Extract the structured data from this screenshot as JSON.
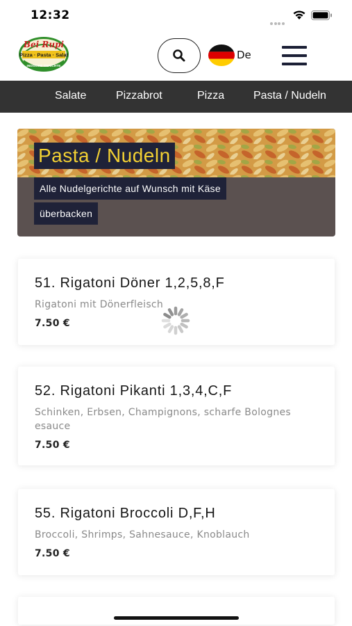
{
  "status_bar": {
    "time": "12:32"
  },
  "header": {
    "logo_text": "Bei Rupi",
    "logo_subtitle": "Pizza · Pasta · Salat",
    "logo_tagline": "INDISCHE GERICHTE",
    "language": "De"
  },
  "nav": {
    "items": [
      "Salate",
      "Pizzabrot",
      "Pizza",
      "Pasta / Nudeln"
    ],
    "active": "Pasta / Nudeln"
  },
  "banner": {
    "title": "Pasta / Nudeln",
    "subtitle_line1": "Alle Nudelgerichte auf Wunsch mit Käse",
    "subtitle_line2": "überbacken"
  },
  "products": [
    {
      "title": "51. Rigatoni Döner 1,2,5,8,F",
      "description": "Rigatoni mit Dönerfleisch",
      "price": "7.50 €"
    },
    {
      "title": "52. Rigatoni Pikanti 1,3,4,C,F",
      "description": "Schinken, Erbsen, Champignons, scharfe Bolognes esauce",
      "price": "7.50 €"
    },
    {
      "title": "55. Rigatoni Broccoli D,F,H",
      "description": "Broccoli, Shrimps, Sahnesauce, Knoblauch",
      "price": "7.50 €"
    }
  ],
  "colors": {
    "nav_bg": "#333333",
    "banner_label_bg": "#1f2238",
    "banner_title_color": "#f2d033",
    "menu_icon": "#1b1f35"
  },
  "icons": [
    "wifi-icon",
    "battery-icon",
    "search-icon",
    "german-flag-icon",
    "hamburger-menu-icon",
    "loading-spinner-icon"
  ]
}
